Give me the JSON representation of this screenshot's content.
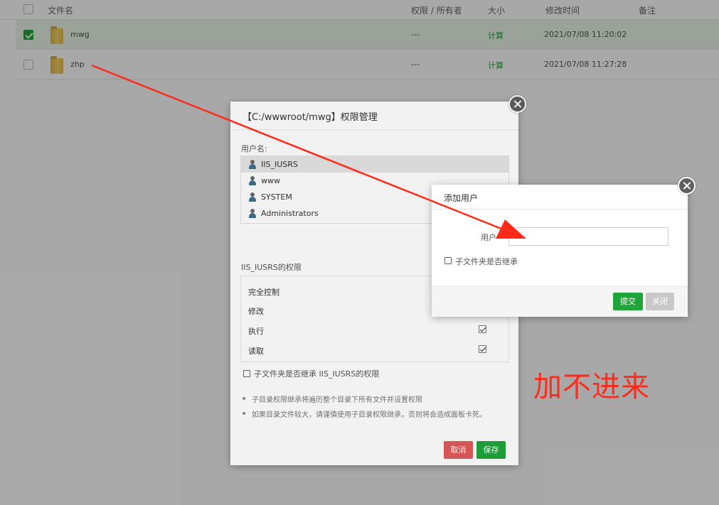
{
  "table": {
    "headers": {
      "filename": "文件名",
      "owner": "权限 / 所有者",
      "size": "大小",
      "mtime": "修改时间",
      "note": "备注"
    },
    "rows": [
      {
        "name": "mwg",
        "owner": "---",
        "size": "计算",
        "mtime": "2021/07/08 11:20:02",
        "checked": true
      },
      {
        "name": "zhp",
        "owner": "---",
        "size": "计算",
        "mtime": "2021/07/08 11:27:28",
        "checked": false
      }
    ]
  },
  "perm_dialog": {
    "title": "【C:/wwwroot/mwg】权限管理",
    "user_label": "用户名:",
    "users": [
      "IIS_IUSRS",
      "www",
      "SYSTEM",
      "Administrators"
    ],
    "selected_user": "IIS_IUSRS",
    "perm_section_label": "IIS_IUSRS的权限",
    "perms": [
      {
        "label": "完全控制",
        "checked": false
      },
      {
        "label": "修改",
        "checked": false
      },
      {
        "label": "执行",
        "checked": true
      },
      {
        "label": "读取",
        "checked": true
      }
    ],
    "inherit_label": "子文件夹是否继承 IIS_IUSRS的权限",
    "notes": [
      "子目录权限继承将遍历整个目录下所有文件并设置权限",
      "如果目录文件较大，请谨慎使用子目录权限继承，否则将会造成面板卡死。"
    ],
    "cancel_label": "取消",
    "save_label": "保存"
  },
  "add_dialog": {
    "title": "添加用户",
    "user_label": "用户",
    "user_value": "",
    "inherit_label": "子文件夹是否继承",
    "submit_label": "提交",
    "close_label": "关闭"
  },
  "annotation": {
    "text": "加不进来",
    "color": "#ff2a1a"
  },
  "colors": {
    "accent_green": "#20a53a",
    "danger_red": "#e25b5b"
  }
}
